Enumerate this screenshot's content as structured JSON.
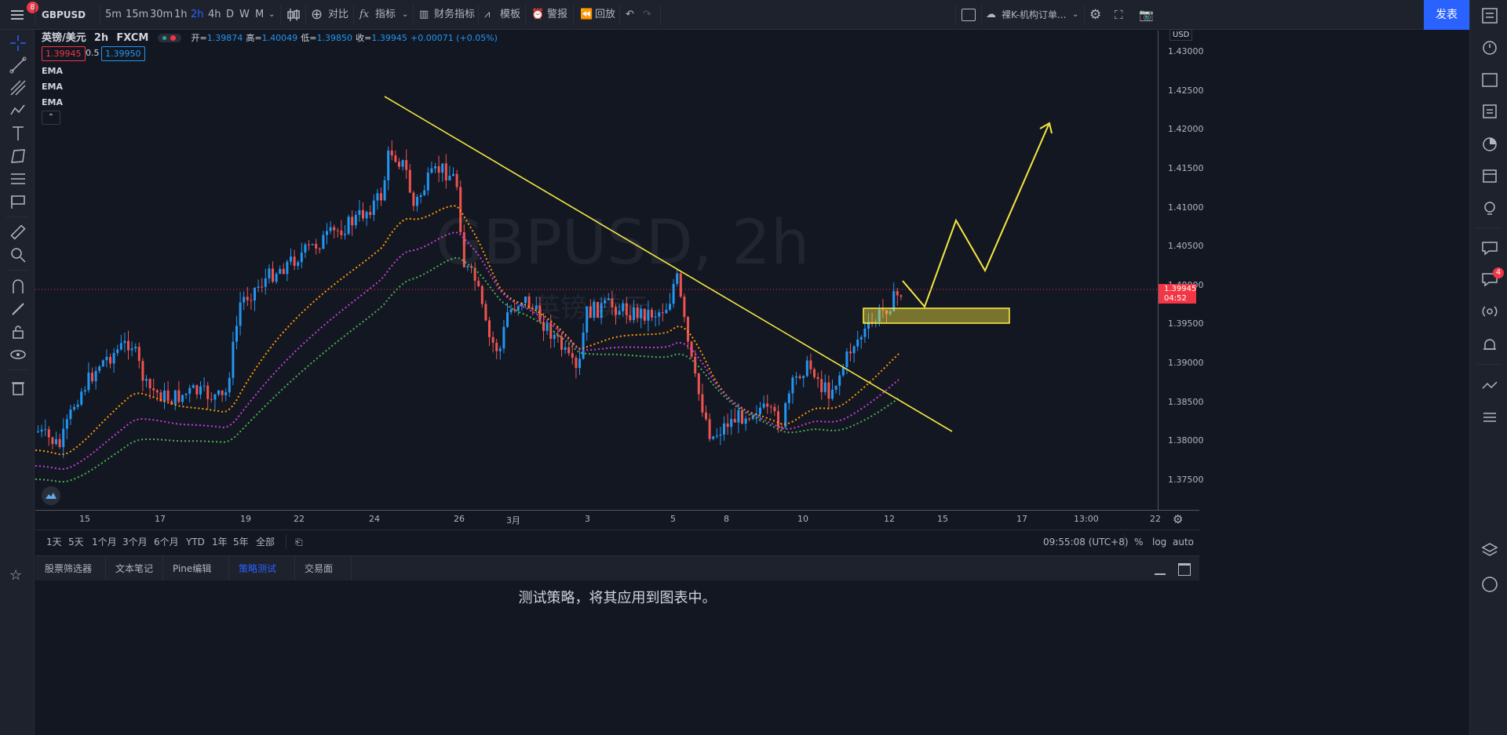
{
  "topbar": {
    "menu_badge": "8",
    "symbol": "GBPUSD",
    "intervals": [
      "5m",
      "15m",
      "30m",
      "1h",
      "2h",
      "4h",
      "D",
      "W",
      "M"
    ],
    "active_interval": "2h",
    "compare": "对比",
    "indicators": "指标",
    "financials": "财务指标",
    "templates": "模板",
    "alert": "警报",
    "replay": "回放",
    "layout_name": "裸K-机构订单...",
    "publish": "发表"
  },
  "legend": {
    "pair": "英镑/美元",
    "interval": "2h",
    "source": "FXCM",
    "open_label": "开=",
    "open": "1.39874",
    "high_label": "高=",
    "high": "1.40049",
    "low_label": "低=",
    "low": "1.39850",
    "close_label": "收=",
    "close": "1.39945",
    "change": "+0.00071 (+0.05%)",
    "bid": "1.39945",
    "spread": "0.5",
    "ask": "1.39950",
    "indicators": [
      "EMA",
      "EMA",
      "EMA"
    ]
  },
  "watermark": {
    "main": "GBPUSD, 2h",
    "sub": "英镑/美元"
  },
  "price_axis": {
    "currency": "USD",
    "ticks": [
      "1.43000",
      "1.42500",
      "1.42000",
      "1.41500",
      "1.41000",
      "1.40500",
      "1.40000",
      "1.39500",
      "1.39000",
      "1.38500",
      "1.38000",
      "1.37500"
    ],
    "last_price": "1.39945",
    "countdown": "04:52"
  },
  "time_axis": {
    "ticks": [
      "15",
      "17",
      "19",
      "22",
      "24",
      "26",
      "3月",
      "3",
      "5",
      "8",
      "10",
      "12",
      "15",
      "17",
      "13:00",
      "22"
    ]
  },
  "range_bar": {
    "ranges": [
      "1天",
      "5天",
      "1个月",
      "3个月",
      "6个月",
      "YTD",
      "1年",
      "5年",
      "全部"
    ],
    "clock": "09:55:08 (UTC+8)",
    "percent": "%",
    "log": "log",
    "auto": "auto"
  },
  "bottom_tabs": {
    "tabs": [
      "股票筛选器",
      "文本笔记",
      "Pine编辑器",
      "策略测试器",
      "交易面板"
    ],
    "active": "策略测试器"
  },
  "bottom_panel": {
    "message": "测试策略，将其应用到图表中。"
  },
  "right_toolbar": {
    "notification_badge": "4"
  },
  "colors": {
    "background": "#131722",
    "up": "#2196f3",
    "down": "#ef5350",
    "ema_fast": "#ff9800",
    "ema_mid": "#c43ed6",
    "ema_slow": "#4caf50",
    "drawing": "#f5e642",
    "accent": "#2962ff"
  }
}
